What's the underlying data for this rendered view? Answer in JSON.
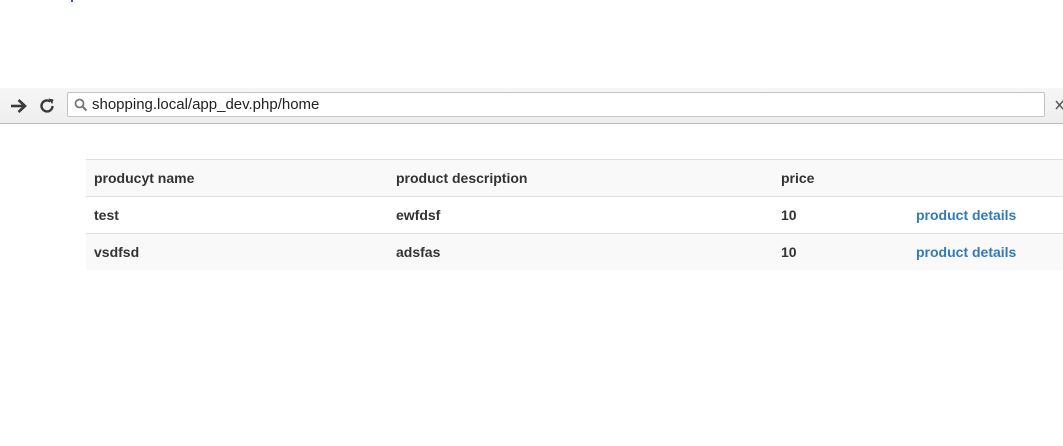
{
  "browser": {
    "url": "shopping.local/app_dev.php/home"
  },
  "table": {
    "headers": [
      "producyt name",
      "product description",
      "price",
      ""
    ],
    "rows": [
      {
        "name": "test",
        "description": "ewfdsf",
        "price": "10",
        "link": "product details"
      },
      {
        "name": "vsdfsd",
        "description": "adsfas",
        "price": "10",
        "link": "product details"
      }
    ]
  },
  "colors": {
    "link": "#337ab7",
    "text": "#333333",
    "stripe": "#f9f9f9"
  },
  "icons": {
    "forward": "arrow-right-icon",
    "reload": "reload-icon",
    "omnibox": "search-icon"
  }
}
